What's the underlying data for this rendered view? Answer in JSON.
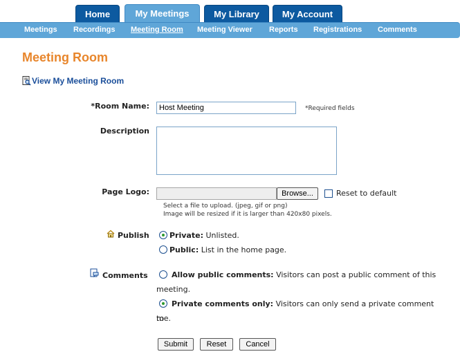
{
  "tabs": [
    {
      "label": "Home"
    },
    {
      "label": "My Meetings"
    },
    {
      "label": "My Library"
    },
    {
      "label": "My Account"
    }
  ],
  "subnav": [
    {
      "label": "Meetings"
    },
    {
      "label": "Recordings"
    },
    {
      "label": "Meeting Room"
    },
    {
      "label": "Meeting Viewer"
    },
    {
      "label": "Reports"
    },
    {
      "label": "Registrations"
    },
    {
      "label": "Comments"
    }
  ],
  "page_title": "Meeting Room",
  "view_link": "View My Meeting Room",
  "form": {
    "room_name_label": "*Room Name:",
    "room_name_value": "Host Meeting",
    "required_note": "*Required fields",
    "description_label": "Description",
    "description_value": "",
    "page_logo_label": "Page Logo:",
    "browse_label": "Browse...",
    "reset_default_label": "Reset to default",
    "upload_note_1": "Select a file to upload. (jpeg, gif or png)",
    "upload_note_2": "Image will be resized if it is larger than 420x80 pixels.",
    "publish_label": "Publish",
    "private_bold": "Private:",
    "private_text": "Unlisted.",
    "public_bold": "Public:",
    "public_text": "List in the home page.",
    "comments_label": "Comments",
    "allow_bold": "Allow public comments:",
    "allow_text_1": "Visitors can post a public comment of this",
    "allow_text_2": "meeting.",
    "private_only_bold": "Private comments only:",
    "private_only_text_1": "Visitors can only send a private comment to",
    "private_only_text_2": "me."
  },
  "buttons": {
    "submit": "Submit",
    "reset": "Reset",
    "cancel": "Cancel"
  },
  "colors": {
    "tab_dark": "#0d5aa0",
    "tab_active": "#5fa6d8",
    "title_orange": "#e8862c",
    "link_blue": "#1a4e9a",
    "radio_selected": "#2d9a2d"
  },
  "icons": {
    "view_link": "document-magnifier-icon",
    "publish": "house-icon",
    "comments": "comment-page-icon"
  }
}
